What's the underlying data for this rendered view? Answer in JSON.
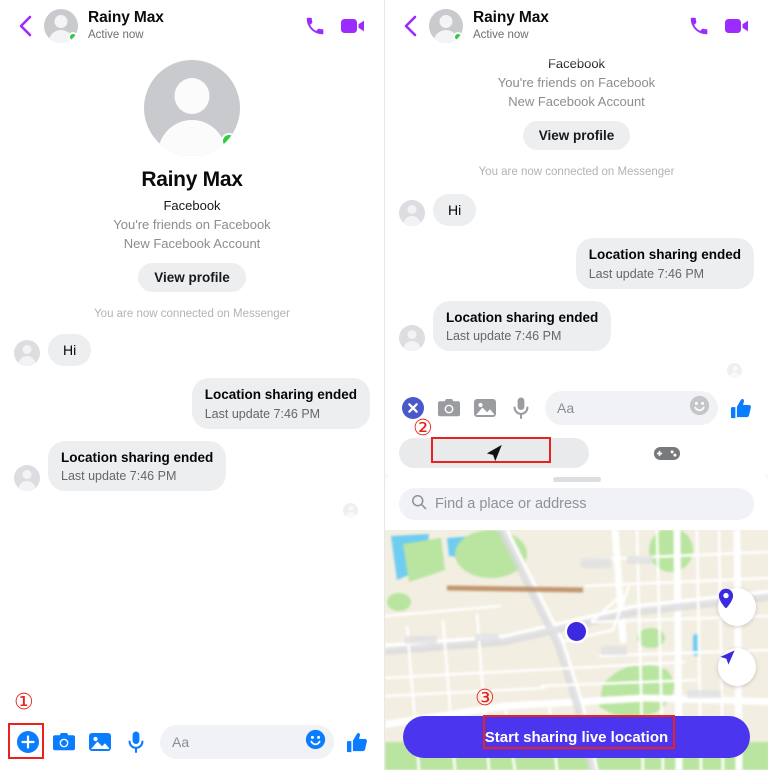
{
  "app": {
    "name": "Messenger"
  },
  "colors": {
    "accent_purple": "#9B2BFF",
    "accent_blue": "#0A7CFF",
    "share_button": "#4B35EE",
    "online_green": "#2ECC40",
    "annotation_red": "#E8231F",
    "bubble_gray": "#ECEEF0"
  },
  "left_panel": {
    "header": {
      "back_icon": "chevron-left-icon",
      "avatar_icon": "person-avatar-icon",
      "presence_badge": "online-dot",
      "name": "Rainy Max",
      "status": "Active now",
      "call_icon": "phone-call-icon",
      "video_icon": "video-camera-icon"
    },
    "profile": {
      "avatar_icon": "person-avatar-large-icon",
      "name": "Rainy Max",
      "platform": "Facebook",
      "relationship": "You're friends on Facebook",
      "account_note": "New Facebook Account",
      "view_profile_label": "View profile",
      "connected_note": "You are now connected on Messenger"
    },
    "messages": [
      {
        "direction": "in",
        "type": "text",
        "text": "Hi"
      },
      {
        "direction": "out",
        "type": "location",
        "title": "Location sharing ended",
        "subtitle": "Last update 7:46 PM"
      },
      {
        "direction": "in",
        "type": "location",
        "title": "Location sharing ended",
        "subtitle": "Last update 7:46 PM"
      }
    ],
    "composer": {
      "plus_icon": "plus-circle-icon",
      "camera_icon": "camera-icon",
      "gallery_icon": "photo-gallery-icon",
      "mic_icon": "microphone-icon",
      "input_placeholder": "Aa",
      "emoji_icon": "smiley-face-icon",
      "like_icon": "thumbs-up-icon"
    }
  },
  "right_panel": {
    "header": {
      "back_icon": "chevron-left-icon",
      "avatar_icon": "person-avatar-icon",
      "presence_badge": "online-dot",
      "name": "Rainy Max",
      "status": "Active now",
      "call_icon": "phone-call-icon",
      "video_icon": "video-camera-icon"
    },
    "profile": {
      "platform": "Facebook",
      "relationship": "You're friends on Facebook",
      "account_note": "New Facebook Account",
      "view_profile_label": "View profile",
      "connected_note": "You are now connected on Messenger"
    },
    "messages": [
      {
        "direction": "in",
        "type": "text",
        "text": "Hi"
      },
      {
        "direction": "out",
        "type": "location",
        "title": "Location sharing ended",
        "subtitle": "Last update 7:46 PM"
      },
      {
        "direction": "in",
        "type": "location",
        "title": "Location sharing ended",
        "subtitle": "Last update 7:46 PM"
      }
    ],
    "composer": {
      "close_icon": "close-circle-icon",
      "camera_icon": "camera-icon",
      "gallery_icon": "photo-gallery-icon",
      "mic_icon": "microphone-icon",
      "input_placeholder": "Aa",
      "emoji_icon": "smiley-face-icon",
      "like_icon": "thumbs-up-icon"
    },
    "tabs": [
      {
        "icon": "location-arrow-icon",
        "selected": true
      },
      {
        "icon": "gamepad-icon",
        "selected": false
      }
    ],
    "location_sheet": {
      "grab_handle": "drag-handle",
      "search_icon": "search-icon",
      "search_placeholder": "Find a place or address",
      "map": {
        "current_position_marker": "blue-location-dot",
        "pin_button_icon": "map-pin-icon",
        "recenter_button_icon": "navigation-arrow-icon"
      },
      "share_button_label": "Start sharing live location"
    }
  },
  "annotations": [
    {
      "number": "①",
      "target": "plus-circle-icon"
    },
    {
      "number": "②",
      "target": "location-arrow-tab"
    },
    {
      "number": "③",
      "target": "start-sharing-live-location-button"
    }
  ]
}
